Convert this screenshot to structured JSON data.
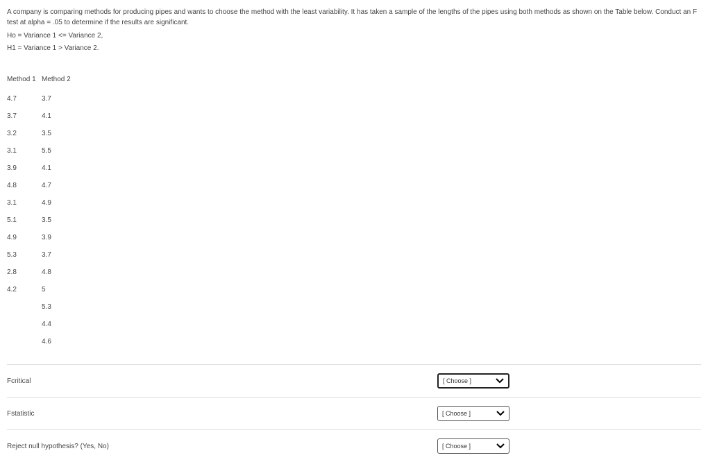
{
  "intro": "A company is comparing methods for producing pipes and wants to choose the method with the least variability. It has taken a sample of the lengths of the pipes using both methods as shown on the Table below. Conduct an F test at alpha = .05 to determine if the results are significant.",
  "hypothesis_ho": "Ho = Variance 1 <= Variance 2,",
  "hypothesis_h1": "H1 = Variance 1 > Variance 2.",
  "table": {
    "headers": [
      "Method 1",
      "Method 2"
    ],
    "rows": [
      [
        "4.7",
        "3.7"
      ],
      [
        "3.7",
        "4.1"
      ],
      [
        "3.2",
        "3.5"
      ],
      [
        "3.1",
        "5.5"
      ],
      [
        "3.9",
        "4.1"
      ],
      [
        "4.8",
        "4.7"
      ],
      [
        "3.1",
        "4.9"
      ],
      [
        "5.1",
        "3.5"
      ],
      [
        "4.9",
        "3.9"
      ],
      [
        "5.3",
        "3.7"
      ],
      [
        "2.8",
        "4.8"
      ],
      [
        "4.2",
        "5"
      ],
      [
        "",
        "5.3"
      ],
      [
        "",
        "4.4"
      ],
      [
        "",
        "4.6"
      ]
    ]
  },
  "questions": {
    "q1_label": "Fcritical",
    "q2_label": "Fstatistic",
    "q3_label": "Reject null hypothesis? (Yes, No)",
    "placeholder": "[ Choose ]"
  }
}
